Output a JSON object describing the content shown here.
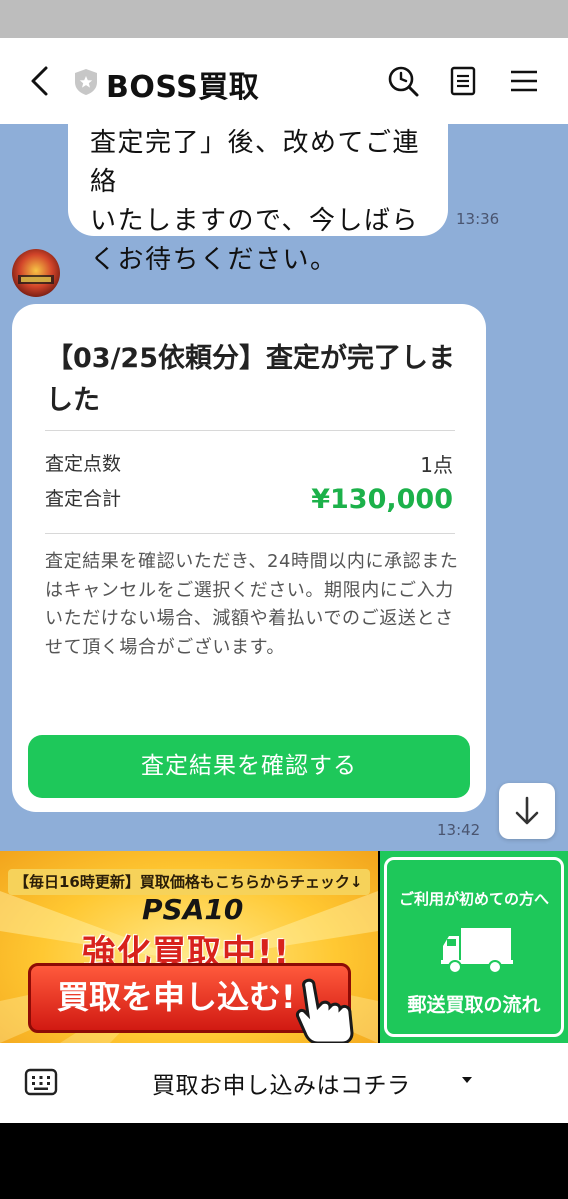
{
  "header": {
    "title": "BOSS買取"
  },
  "chat": {
    "prev_message_lines": [
      "査定完了」後、改めてご連絡",
      "いたしますので、今しばら",
      "くお待ちください。"
    ],
    "prev_message_time": "13:36",
    "card": {
      "title": "【03/25依頼分】査定が完了しました",
      "count_label": "査定点数",
      "count_value": "1点",
      "total_label": "査定合計",
      "total_value": "¥130,000",
      "description": "査定結果を確認いただき、24時間以内に承認またはキャンセルをご選択ください。期限内にご入力いただけない場合、減額や着払いでのご返送とさせて頂く場合がございます。",
      "button_label": "査定結果を確認する"
    },
    "card_time": "13:42"
  },
  "rich_menu": {
    "left_strip": "【毎日16時更新】買取価格もこちらからチェック↓",
    "left_psa": "PSA10",
    "left_headline": "強化買取中!!",
    "left_button": "買取を申し込む!",
    "right_top": "ご利用が初めての方へ",
    "right_bottom": "郵送買取の流れ"
  },
  "bottom_bar": {
    "menu_label": "買取お申し込みはコチラ"
  },
  "colors": {
    "chat_bg": "#8eaed8",
    "accent_green": "#1ec85a",
    "price_green": "#1cb14a",
    "banner_red": "#d8221c"
  }
}
